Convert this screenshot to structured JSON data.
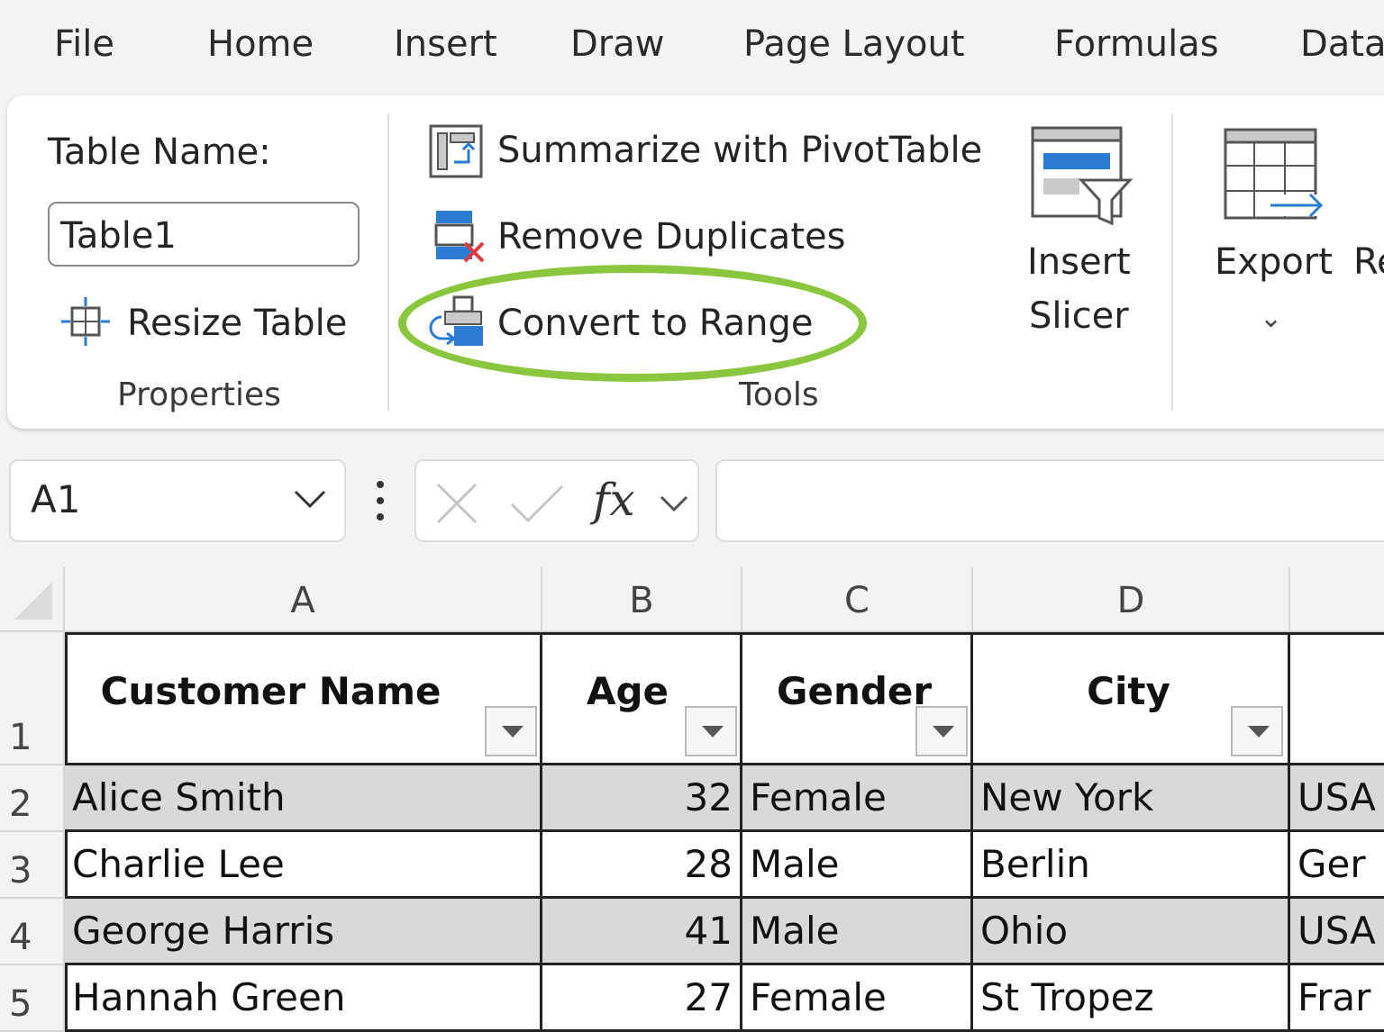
{
  "menu_tabs": [
    "File",
    "Home",
    "Insert",
    "Draw",
    "Page Layout",
    "Formulas",
    "Data"
  ],
  "ribbon": {
    "properties": {
      "table_name_label": "Table Name:",
      "table_name_value": "Table1",
      "resize_table_label": "Resize Table",
      "group_label": "Properties"
    },
    "tools": {
      "summarize_label": "Summarize with PivotTable",
      "remove_duplicates_label": "Remove Duplicates",
      "convert_to_range_label": "Convert to Range",
      "insert_slicer_label_line1": "Insert",
      "insert_slicer_label_line2": "Slicer",
      "group_label": "Tools"
    },
    "external": {
      "export_label": "Export",
      "refresh_label_partial": "Re"
    },
    "highlight_color": "#8bc63f"
  },
  "formula_bar": {
    "name_box_value": "A1",
    "fx_label": "fx",
    "formula_value": ""
  },
  "sheet": {
    "column_headers": [
      "A",
      "B",
      "C",
      "D"
    ],
    "row_headers": [
      "1",
      "2",
      "3",
      "4",
      "5"
    ],
    "header_row": [
      "Customer Name",
      "Age",
      "Gender",
      "City"
    ],
    "rows": [
      [
        "Alice Smith",
        "32",
        "Female",
        "New York",
        "USA"
      ],
      [
        "Charlie Lee",
        "28",
        "Male",
        "Berlin",
        "Ger"
      ],
      [
        "George Harris",
        "41",
        "Male",
        "Ohio",
        "USA"
      ],
      [
        "Hannah Green",
        "27",
        "Female",
        "St Tropez",
        "Frar"
      ]
    ],
    "band_color": "#d9d9d9"
  }
}
